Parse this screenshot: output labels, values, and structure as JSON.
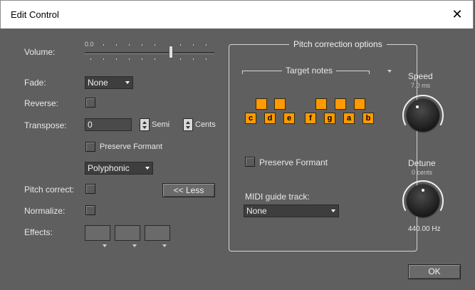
{
  "window": {
    "title": "Edit Control",
    "close_glyph": "✕"
  },
  "left": {
    "volume_label": "Volume:",
    "volume_value": "0.0",
    "fade_label": "Fade:",
    "fade_value": "None",
    "reverse_label": "Reverse:",
    "transpose_label": "Transpose:",
    "transpose_value": "0",
    "semi_label": "Semi",
    "cents_label": "Cents",
    "preserve_formant_label": "Preserve Formant",
    "mode_value": "Polyphonic",
    "pitch_correct_label": "Pitch correct:",
    "less_button": "<< Less",
    "normalize_label": "Normalize:",
    "effects_label": "Effects:"
  },
  "pitch": {
    "group_title": "Pitch correction options",
    "target_notes_label": "Target notes",
    "notes": [
      "c",
      "d",
      "e",
      "f",
      "g",
      "a",
      "b"
    ],
    "preserve_formant_label": "Preserve Formant",
    "midi_guide_label": "MIDI guide track:",
    "midi_guide_value": "None",
    "speed_label": "Speed",
    "speed_value": "7.0 ms",
    "detune_label": "Detune",
    "detune_value": "0 cents",
    "detune_hz": "440.00 Hz"
  },
  "footer": {
    "ok_button": "OK"
  },
  "colors": {
    "background": "#5f5f5f",
    "key_orange": "#ff9a00"
  }
}
